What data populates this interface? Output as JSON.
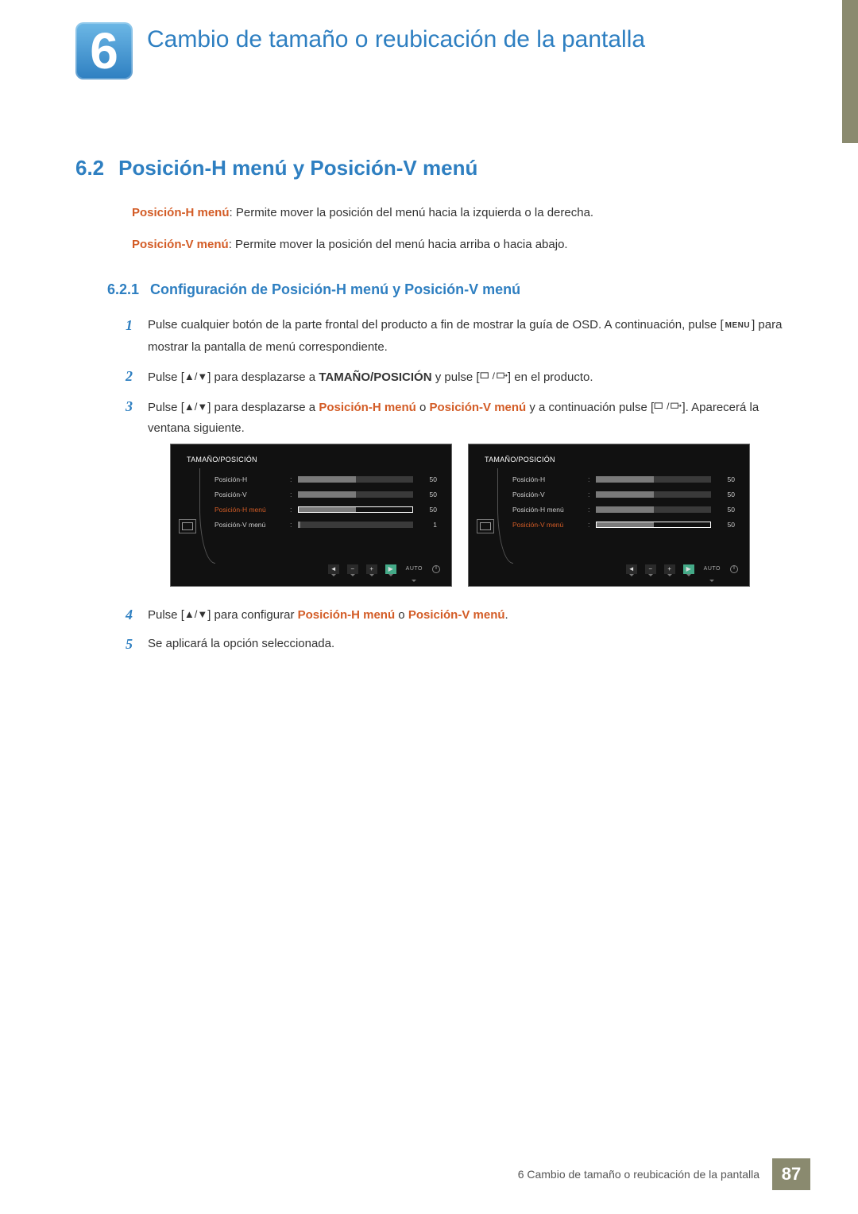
{
  "chapter": {
    "number": "6",
    "title": "Cambio de tamaño o reubicación de la pantalla"
  },
  "section": {
    "number": "6.2",
    "title": "Posición-H menú y Posición-V menú"
  },
  "intro": {
    "p1_term": "Posición-H menú",
    "p1_rest": ": Permite mover la posición del menú hacia la izquierda o la derecha.",
    "p2_term": "Posición-V menú",
    "p2_rest": ": Permite mover la posición del menú hacia arriba o hacia abajo."
  },
  "subsection": {
    "number": "6.2.1",
    "title": "Configuración de Posición-H menú y Posición-V menú"
  },
  "steps": {
    "s1_a": "Pulse cualquier botón de la parte frontal del producto a fin de mostrar la guía de OSD. A continuación, pulse [",
    "s1_menu": "MENU",
    "s1_b": "] para mostrar la pantalla de menú correspondiente.",
    "s2_a": "Pulse [",
    "s2_b": "] para desplazarse a ",
    "s2_bold": "TAMAÑO/POSICIÓN",
    "s2_c": " y pulse [",
    "s2_d": "] en el producto.",
    "s3_a": "Pulse [",
    "s3_b": "] para desplazarse a ",
    "s3_hl1": "Posición-H menú",
    "s3_mid": " o ",
    "s3_hl2": "Posición-V menú",
    "s3_c": " y a continuación pulse [",
    "s3_d": "]. Aparecerá la ventana siguiente.",
    "s4_a": "Pulse [",
    "s4_b": "] para configurar ",
    "s4_hl1": "Posición-H menú",
    "s4_mid": " o ",
    "s4_hl2": "Posición-V menú",
    "s4_c": ".",
    "s5": "Se aplicará la opción seleccionada."
  },
  "osd": {
    "title": "TAMAÑO/POSICIÓN",
    "items": [
      {
        "label": "Posición-H",
        "value": "50",
        "fill": 50
      },
      {
        "label": "Posición-V",
        "value": "50",
        "fill": 50
      },
      {
        "label": "Posición-H menú",
        "value": "50",
        "fill": 50
      },
      {
        "label": "Posición-V menú",
        "value": "1",
        "fill": 2
      }
    ],
    "auto": "AUTO",
    "left_active_index": 2,
    "right_active_index": 3,
    "right_active_value": "50",
    "right_active_fill": 50
  },
  "footer": {
    "text": "6 Cambio de tamaño o reubicación de la pantalla",
    "page": "87"
  }
}
